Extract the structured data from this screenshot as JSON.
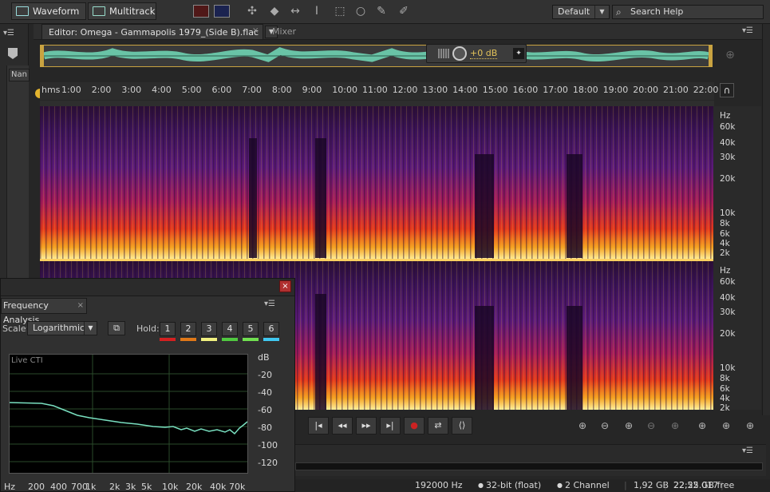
{
  "toolbar": {
    "waveform_label": "Waveform",
    "multitrack_label": "Multitrack",
    "workspace": "Default",
    "search_label": "Search Help"
  },
  "editor": {
    "tab_label": "Editor: Omega - Gammapolis 1979_(Side B).flac",
    "mixer_label": "Mixer",
    "hud_gain": "+0 dB",
    "left_panel_label": "Nan"
  },
  "ruler": {
    "unit": "hms",
    "ticks": [
      "1:00",
      "2:00",
      "3:00",
      "4:00",
      "5:00",
      "6:00",
      "7:00",
      "8:00",
      "9:00",
      "10:00",
      "11:00",
      "12:00",
      "13:00",
      "14:00",
      "15:00",
      "16:00",
      "17:00",
      "18:00",
      "19:00",
      "20:00",
      "21:00",
      "22:00"
    ]
  },
  "freq_scale": {
    "unit": "Hz",
    "labels": [
      "60k",
      "40k",
      "30k",
      "20k",
      "10k",
      "8k",
      "6k",
      "4k",
      "2k"
    ]
  },
  "status": {
    "sample_rate": "192000 Hz",
    "bit_depth": "32-bit (float)",
    "channels": "2 Channel",
    "file_size": "1,92 GB",
    "duration": "22:25.017",
    "free_space": "22,52 GB free"
  },
  "freq_analysis": {
    "title": "Frequency Analysis",
    "scale_label": "Scale:",
    "scale_value": "Logarithmic",
    "hold_label": "Hold:",
    "hold_buttons": [
      "1",
      "2",
      "3",
      "4",
      "5",
      "6"
    ],
    "hold_colors": [
      "#d42020",
      "#e07818",
      "#f0f080",
      "#50c840",
      "#70e050",
      "#40c8f0"
    ],
    "plot_label": "Live CTI",
    "db_unit": "dB",
    "db_labels": [
      "-20",
      "-40",
      "-60",
      "-80",
      "-100",
      "-120"
    ],
    "freq_labels": [
      "Hz",
      "200",
      "400",
      "700",
      "1k",
      "2k",
      "3k",
      "5k",
      "10k",
      "20k",
      "40k",
      "70k"
    ]
  },
  "colors": {
    "accent": "#c9a341",
    "waveform": "#6fd3b2",
    "curve": "#79e0c0"
  }
}
